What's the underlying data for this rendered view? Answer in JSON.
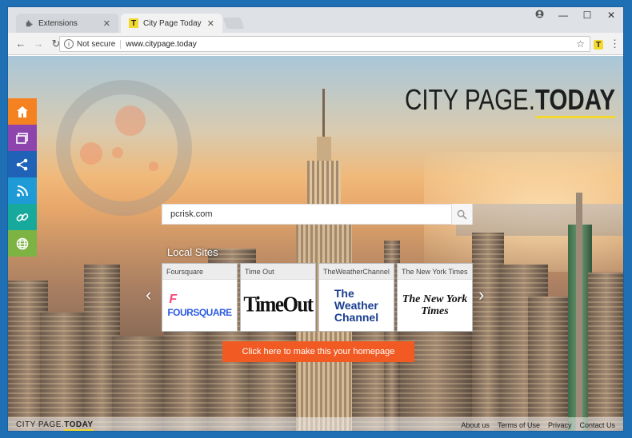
{
  "browser": {
    "tabs": [
      {
        "title": "Extensions",
        "icon": "puzzle-icon"
      },
      {
        "title": "City Page Today Home P",
        "icon": "citypage-icon"
      }
    ],
    "address_bar": {
      "security_label": "Not secure",
      "url": "www.citypage.today"
    },
    "extension_glyph": "T"
  },
  "page": {
    "brand": {
      "part1": "CITY PAGE.",
      "part2": "TODAY"
    },
    "search": {
      "value": "pcrisk.com",
      "placeholder": ""
    },
    "local_sites_title": "Local Sites",
    "tiles": [
      {
        "name": "Foursquare",
        "logo_text": "FOURSQUARE",
        "logo_glyph": "F"
      },
      {
        "name": "Time Out",
        "logo_text": "TimeOut"
      },
      {
        "name": "TheWeatherChannel",
        "logo_line1": "The",
        "logo_line2": "Weather",
        "logo_line3": "Channel"
      },
      {
        "name": "The New York Times",
        "logo_line1": "The New York",
        "logo_line2": "Times"
      }
    ],
    "cta_label": "Click here to make this your homepage",
    "footer": {
      "logo_part1": "CITY PAGE.",
      "logo_part2": "TODAY",
      "links": [
        "About us",
        "Terms of Use",
        "Privacy",
        "Contact Us"
      ]
    },
    "sidebar": [
      {
        "name": "home",
        "color": "#f58220"
      },
      {
        "name": "windows",
        "color": "#8e44ad"
      },
      {
        "name": "share",
        "color": "#1f62b8"
      },
      {
        "name": "rss",
        "color": "#1e9bd7"
      },
      {
        "name": "link",
        "color": "#16a99c"
      },
      {
        "name": "globe",
        "color": "#7cb342"
      }
    ]
  },
  "colors": {
    "accent_yellow": "#f3d92e",
    "cta_orange": "#f15a22"
  }
}
